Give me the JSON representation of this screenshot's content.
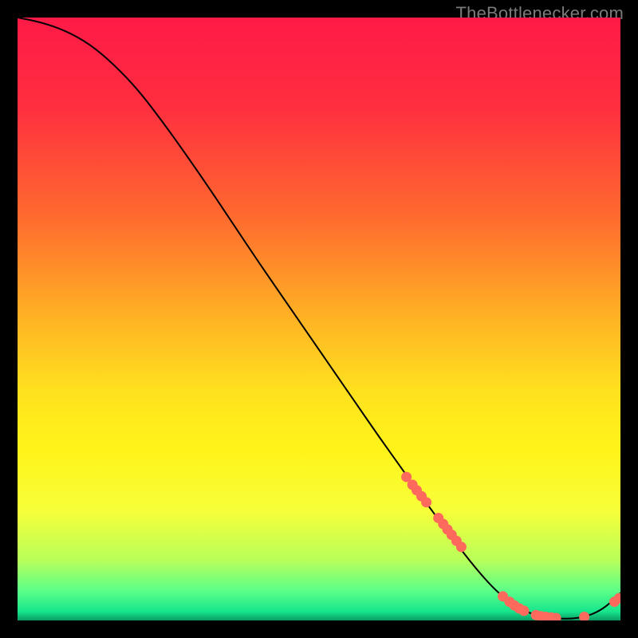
{
  "watermark": "TheBottlenecker.com",
  "chart_data": {
    "type": "line",
    "title": "",
    "xlabel": "",
    "ylabel": "",
    "xlim": [
      0,
      100
    ],
    "ylim": [
      0,
      100
    ],
    "grid": false,
    "legend": false,
    "gradient_stops": [
      {
        "pos": 0.0,
        "color": "#ff1a47"
      },
      {
        "pos": 0.15,
        "color": "#ff2f3f"
      },
      {
        "pos": 0.33,
        "color": "#ff6a2f"
      },
      {
        "pos": 0.5,
        "color": "#ffb324"
      },
      {
        "pos": 0.62,
        "color": "#ffe11e"
      },
      {
        "pos": 0.72,
        "color": "#fff41a"
      },
      {
        "pos": 0.82,
        "color": "#f6ff3a"
      },
      {
        "pos": 0.9,
        "color": "#b8ff5a"
      },
      {
        "pos": 0.95,
        "color": "#5dff88"
      },
      {
        "pos": 0.985,
        "color": "#17e58c"
      },
      {
        "pos": 1.0,
        "color": "#0a9c63"
      }
    ],
    "series": [
      {
        "name": "curve",
        "type": "line",
        "color": "#000000",
        "x": [
          0,
          4,
          8,
          12,
          16,
          20,
          24,
          28,
          32,
          36,
          40,
          44,
          48,
          52,
          56,
          60,
          64,
          68,
          72,
          76,
          80,
          84,
          86,
          88,
          90,
          92,
          94,
          96,
          98,
          100
        ],
        "y": [
          100,
          99.2,
          97.8,
          95.6,
          92.2,
          88.0,
          82.8,
          77.2,
          71.4,
          65.4,
          59.4,
          53.6,
          47.8,
          42.0,
          36.2,
          30.4,
          24.8,
          19.2,
          13.8,
          8.6,
          4.2,
          1.6,
          0.9,
          0.5,
          0.3,
          0.3,
          0.6,
          1.3,
          2.6,
          4.6
        ]
      },
      {
        "name": "markers",
        "type": "scatter",
        "color": "#ff6a5c",
        "x": [
          64.5,
          65.5,
          66.2,
          67.0,
          67.8,
          69.8,
          70.6,
          71.3,
          72.0,
          72.8,
          73.6,
          80.5,
          81.6,
          82.4,
          83.2,
          84.0,
          86.0,
          86.8,
          87.6,
          88.5,
          89.3,
          94.0,
          99.0,
          99.8
        ],
        "y": [
          23.8,
          22.5,
          21.6,
          20.6,
          19.6,
          17.0,
          16.0,
          15.1,
          14.2,
          13.2,
          12.2,
          4.0,
          3.1,
          2.5,
          2.0,
          1.6,
          0.9,
          0.7,
          0.6,
          0.5,
          0.4,
          0.6,
          3.1,
          3.7
        ]
      }
    ]
  }
}
